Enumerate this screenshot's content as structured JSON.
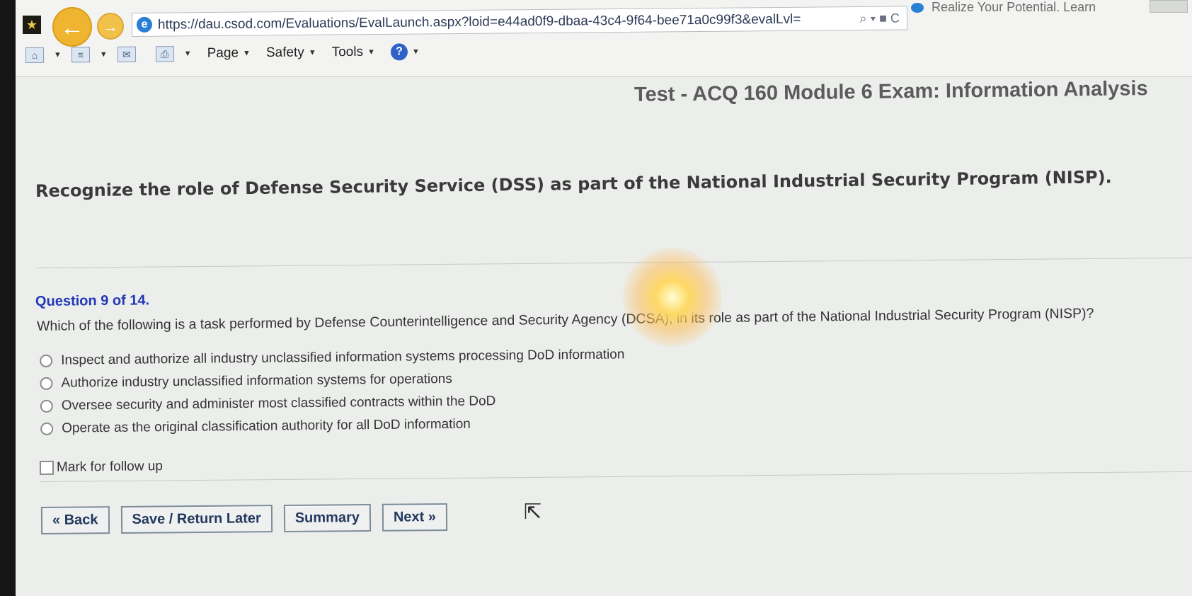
{
  "browser": {
    "url": "https://dau.csod.com/Evaluations/EvalLaunch.aspx?loid=e44ad0f9-dbaa-43c4-9f64-bee71a0c99f3&evalLvl=",
    "tab_title": "Realize Your Potential. Learn",
    "address_controls": "⌕ ▾ ■ C",
    "menus": {
      "page": "Page",
      "safety": "Safety",
      "tools": "Tools"
    }
  },
  "page": {
    "title": "Test - ACQ 160 Module 6 Exam: Information Analysis",
    "objective": "Recognize the role of Defense Security Service (DSS) as part of the National Industrial Security Program (NISP).",
    "question_number": "Question 9 of 14.",
    "question_text": "Which of the following is a task performed by Defense Counterintelligence and Security Agency (DCSA), in its role as part of the National Industrial Security Program (NISP)?",
    "options": [
      "Inspect and authorize all industry unclassified information systems processing DoD information",
      "Authorize industry unclassified information systems for operations",
      "Oversee security and administer most classified contracts within the DoD",
      "Operate as the original classification authority for all DoD information"
    ],
    "followup_label": "Mark for follow up",
    "buttons": {
      "back": "« Back",
      "save": "Save / Return Later",
      "summary": "Summary",
      "next": "Next »"
    }
  }
}
